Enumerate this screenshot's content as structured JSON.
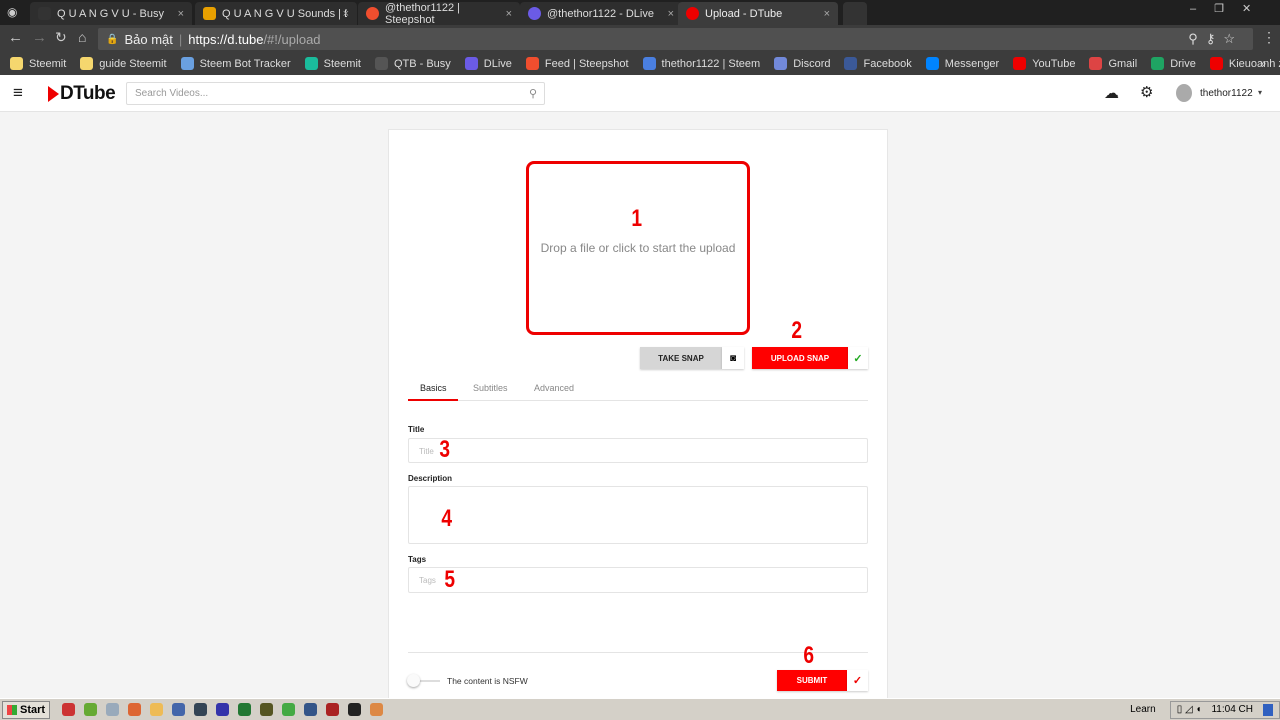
{
  "browser": {
    "tabs": [
      {
        "title": "Q U A N G V U - Busy",
        "color": "#333"
      },
      {
        "title": "Q U A N G V U Sounds | DS",
        "color": "#e8a000"
      },
      {
        "title": "@thethor1122 | Steepshot",
        "color": "#f04e2e"
      },
      {
        "title": "@thethor1122 - DLive",
        "color": "#6b5be6"
      },
      {
        "title": "Upload - DTube",
        "color": "#e00"
      }
    ],
    "security_label": "Bảo mật",
    "url_host": "https://d.tube",
    "url_path": "/#!/upload",
    "bookmarks": [
      {
        "label": "Steemit",
        "color": "#f5d76e"
      },
      {
        "label": "guide Steemit",
        "color": "#f5d76e"
      },
      {
        "label": "Steem Bot Tracker",
        "color": "#6aa0e0"
      },
      {
        "label": "Steemit",
        "color": "#1abc9c"
      },
      {
        "label": "QTB - Busy",
        "color": "#555"
      },
      {
        "label": "DLive",
        "color": "#6b5be6"
      },
      {
        "label": "Feed | Steepshot",
        "color": "#f04e2e"
      },
      {
        "label": "thethor1122 | Steem",
        "color": "#4a7fe0"
      },
      {
        "label": "Discord",
        "color": "#7289da"
      },
      {
        "label": "Facebook",
        "color": "#3b5998"
      },
      {
        "label": "Messenger",
        "color": "#0084ff"
      },
      {
        "label": "YouTube",
        "color": "#e00"
      },
      {
        "label": "Gmail",
        "color": "#d44"
      },
      {
        "label": "Drive",
        "color": "#1fa463"
      },
      {
        "label": "Kieuoanh zoe - YouTu",
        "color": "#e00"
      }
    ],
    "more": "»"
  },
  "app": {
    "logo": "DTube",
    "search_placeholder": "Search Videos...",
    "username": "thethor1122",
    "accent": "#ff0000"
  },
  "upload": {
    "drop_text": "Drop a file or click to start the upload",
    "take_snap": "TAKE SNAP",
    "upload_snap": "UPLOAD SNAP",
    "tabs": [
      "Basics",
      "Subtitles",
      "Advanced"
    ],
    "active_tab": "Basics",
    "title_label": "Title",
    "title_placeholder": "Title",
    "description_label": "Description",
    "tags_label": "Tags",
    "tags_placeholder": "Tags",
    "nsfw_label": "The content is NSFW",
    "nsfw_on": false,
    "submit": "SUBMIT"
  },
  "annotations": [
    "1",
    "2",
    "3",
    "4",
    "5",
    "6"
  ],
  "taskbar": {
    "start": "Start",
    "learn": "Learn",
    "clock": "11:04 CH"
  }
}
